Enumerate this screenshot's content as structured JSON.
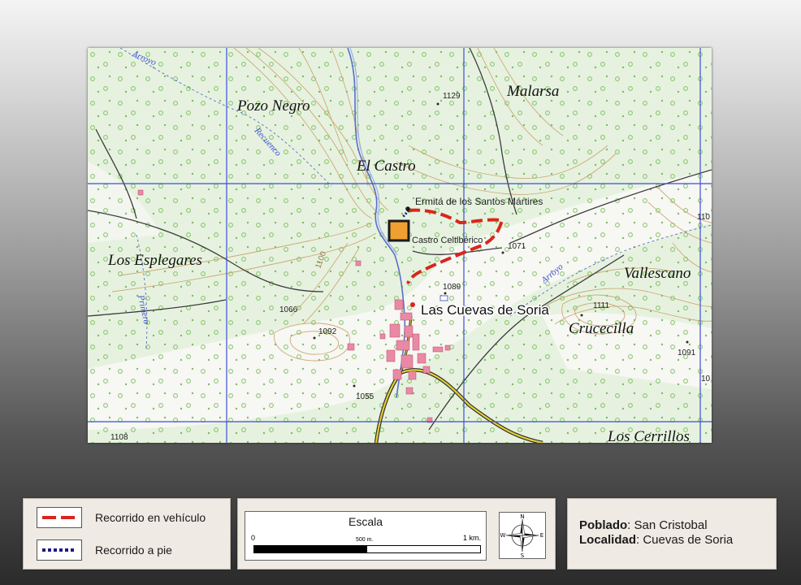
{
  "map": {
    "place_names": {
      "pozo_negro": "Pozo Negro",
      "malarsa": "Malarsa",
      "el_castro": "El Castro",
      "los_esplegares": "Los Esplegares",
      "vallescano": "Vallescano",
      "crucecilla": "Crucecilla",
      "los_cerrillos": "Los Cerrillos",
      "las_cuevas": "Las Cuevas de Soria"
    },
    "features": {
      "ermita": "Ermita de los Santos Mártires",
      "castro_celtiberico": "Castro  Celtibérico"
    },
    "streams": {
      "arroyo_top": "Arroyo",
      "recuenco": "Recuenco",
      "primero": "Primero",
      "arroyo_right": "Arroyo"
    },
    "elevations": {
      "e1129": "1129",
      "e1071": "1071",
      "e1089": "1089",
      "e1066": "1066",
      "e1092": "1092",
      "e1111": "1111",
      "e1091": "1091",
      "e1055": "1055",
      "e1108": "1108",
      "contour_1100": "1100",
      "edge_110": "110",
      "edge_10": "10"
    },
    "colors": {
      "vehicle_route": "#d9261c",
      "foot_route": "#1a1a8c",
      "castro_marker": "#f0a030",
      "grid": "#3a4fd8",
      "contour": "#c9a26b",
      "water": "#5a6fc8"
    }
  },
  "legend": {
    "vehicle_label": "Recorrido en vehículo",
    "foot_label": "Recorrido a pie"
  },
  "scale": {
    "title": "Escala",
    "start": "0",
    "mid": "500 m.",
    "end": "1 km.",
    "compass": {
      "n": "N",
      "s": "S",
      "e": "E",
      "w": "W"
    }
  },
  "info": {
    "poblado_key": "Poblado",
    "poblado_value": ": San Cristobal",
    "localidad_key": "Localidad",
    "localidad_value": ": Cuevas de Soria"
  }
}
